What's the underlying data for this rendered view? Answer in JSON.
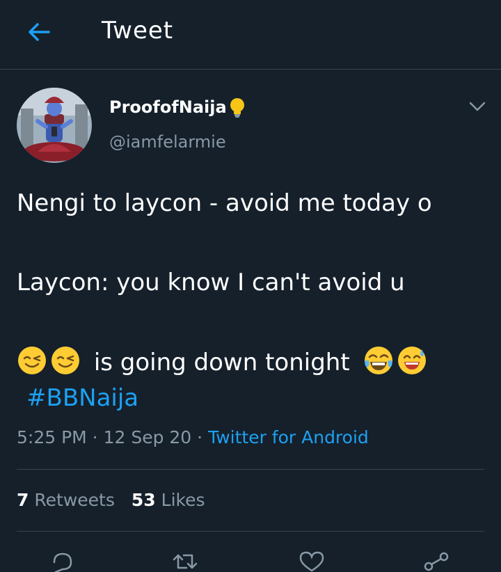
{
  "header": {
    "title": "Tweet",
    "back_icon": "arrow-left-icon"
  },
  "author": {
    "display_name": "ProofofNaija",
    "badge_icon": "lightbulb-icon",
    "handle": "@iamfelarmie",
    "avatar_icon": "avatar-image"
  },
  "tweet": {
    "line1": "Nengi to laycon - avoid me today o",
    "line2": "Laycon: you know I can't avoid u",
    "line3_text": "is going down tonight",
    "hashtag": "#BBNaija"
  },
  "meta": {
    "time": "5:25 PM",
    "separator": " · ",
    "date": "12 Sep 20",
    "source": "Twitter for Android"
  },
  "stats": {
    "retweets_count": "7",
    "retweets_label": "Retweets",
    "likes_count": "53",
    "likes_label": "Likes"
  },
  "actions": [
    "reply-icon",
    "retweet-icon",
    "like-icon",
    "share-icon"
  ],
  "colors": {
    "background": "#15202b",
    "accent": "#1da1f2",
    "muted": "#8899a6",
    "divider": "#38444d"
  }
}
